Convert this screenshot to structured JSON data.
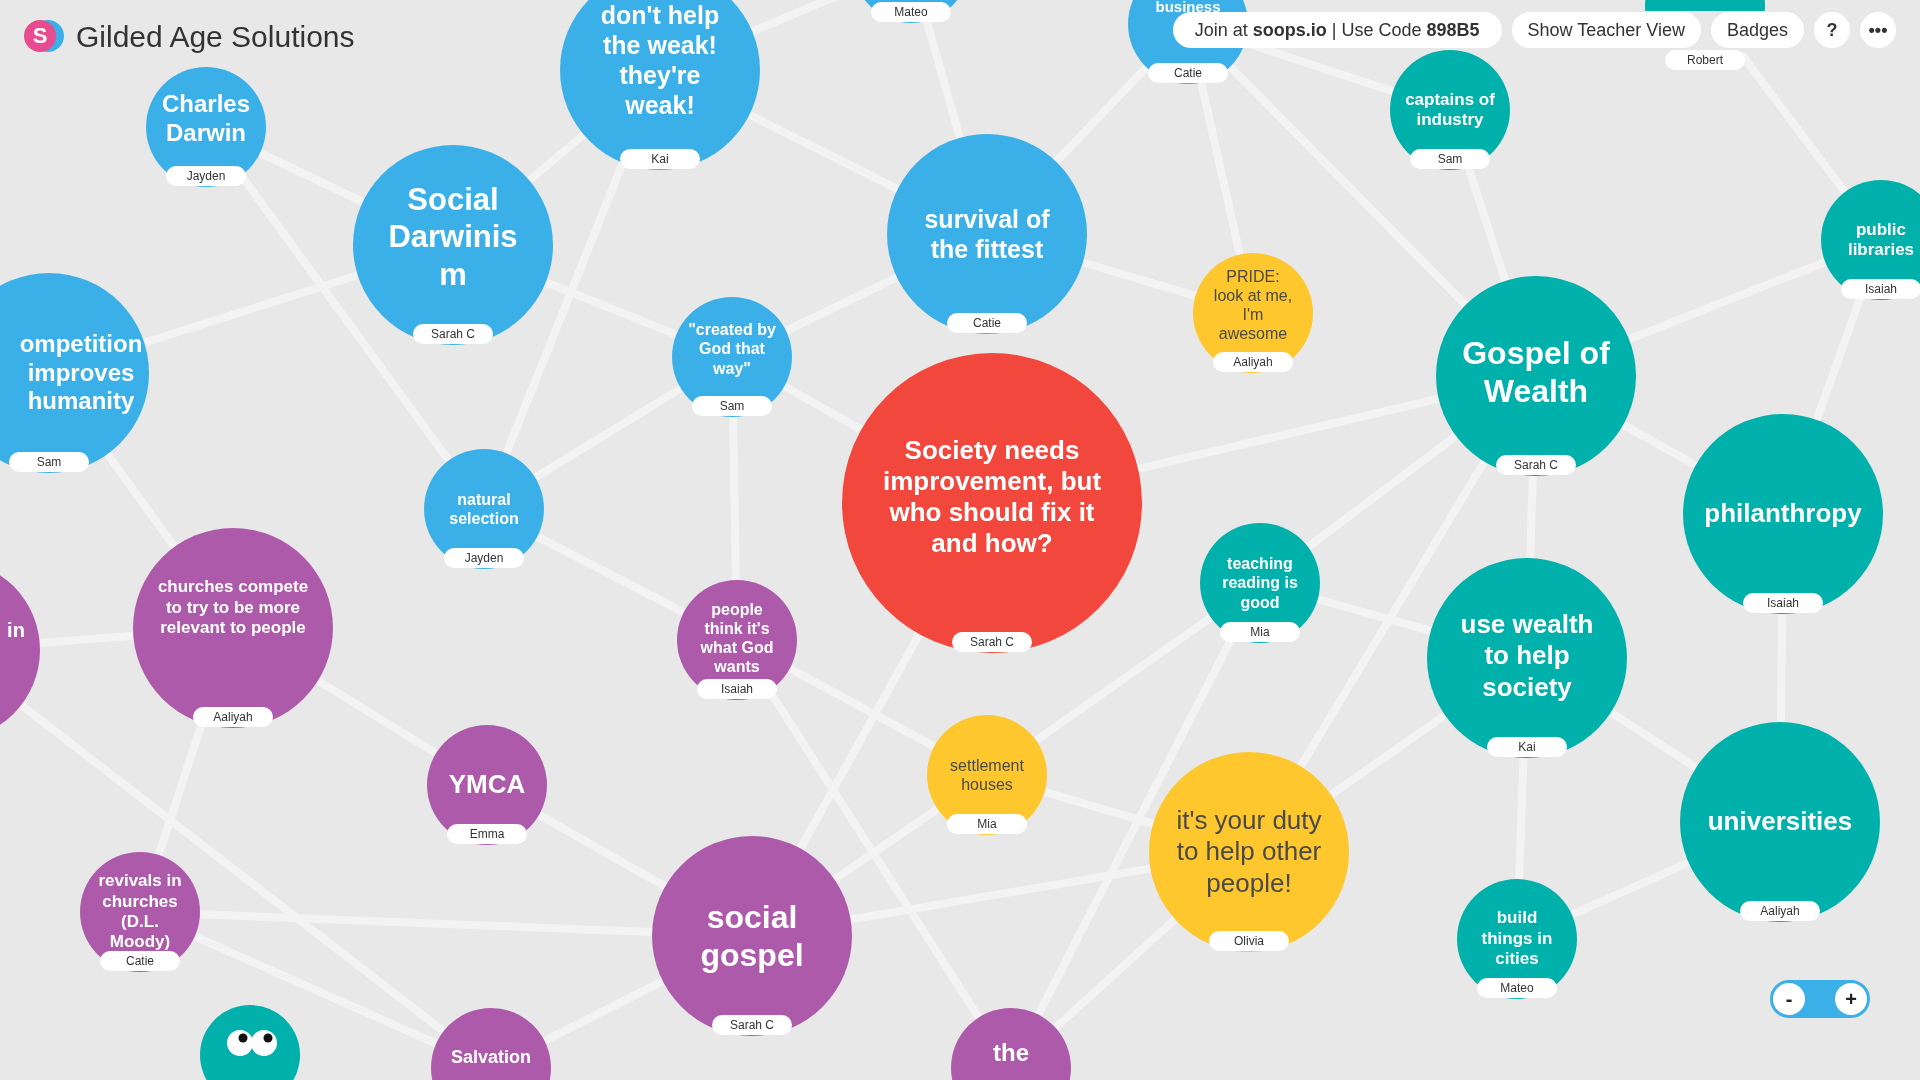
{
  "app": {
    "title": "Gilded Age Solutions",
    "logo": "S"
  },
  "toolbar": {
    "join_text": "Join at **soops.io** | Use Code **898B5**",
    "buttons": [
      "Show Teacher View",
      "Badges",
      "?",
      "•••"
    ]
  },
  "nodes": [
    {
      "text": "Charles\nDarwin",
      "author": "Jayden",
      "color": "#3bb0e8"
    },
    {
      "text": "Social\nDarwinis\nm",
      "author": "Sarah C",
      "color": "#3bb0e8"
    },
    {
      "text": "don't help\nthe weak!\nthey're\nweak!",
      "author": "Kai",
      "color": "#3bb0e8"
    },
    {
      "author": "Mateo",
      "color": "#3bb0e8"
    },
    {
      "text": "survival of\nthe fittest",
      "author": "Catie",
      "color": "#3bb0e8"
    },
    {
      "text": "business",
      "author": "Catie",
      "color": "#3bb0e8"
    },
    {
      "text": "captains of\nindustry",
      "author": "Sam",
      "color": "#00b0aa"
    },
    {
      "author": "Robert",
      "color": "#00b0aa"
    },
    {
      "text": "public\nlibraries",
      "author": "Isaiah",
      "color": "#00b0aa"
    },
    {
      "text": "ompetition\nimproves\nhumanity",
      "author": "Sam",
      "color": "#3bb0e8"
    },
    {
      "text": "\"created by\nGod that\nway\"",
      "author": "Sam",
      "color": "#3bb0e8"
    },
    {
      "text": "PRIDE:\nlook at me,\nI'm\nawesome",
      "author": "Aaliyah",
      "color": "#fec72d"
    },
    {
      "text": "Gospel of\nWealth",
      "author": "Sarah C",
      "color": "#00b0aa"
    },
    {
      "text": "natural\nselection",
      "author": "Jayden",
      "color": "#3bb0e8"
    },
    {
      "text": "Society needs\nimprovement, but\nwho should fix it\nand how?",
      "author": "Sarah C",
      "color": "#f2473d"
    },
    {
      "text": "philanthropy",
      "author": "Isaiah",
      "color": "#00b0aa"
    },
    {
      "text": "in",
      "color": "#ae5aab"
    },
    {
      "text": "churches compete\nto try to be more\nrelevant to people",
      "author": "Aaliyah",
      "color": "#ae5aab"
    },
    {
      "text": "people\nthink it's\nwhat God\nwants",
      "author": "Isaiah",
      "color": "#ae5aab"
    },
    {
      "text": "teaching\nreading is\ngood",
      "author": "Mia",
      "color": "#00b0aa"
    },
    {
      "text": "use wealth\nto help\nsociety",
      "author": "Kai",
      "color": "#00b0aa"
    },
    {
      "text": "YMCA",
      "author": "Emma",
      "color": "#ae5aab"
    },
    {
      "text": "settlement\nhouses",
      "author": "Mia",
      "color": "#fec72d"
    },
    {
      "text": "it's your duty\nto help other\npeople!",
      "author": "Olivia",
      "color": "#fec72d"
    },
    {
      "text": "universities",
      "author": "Aaliyah",
      "color": "#00b0aa"
    },
    {
      "text": "revivals in\nchurches\n(D.L.\nMoody)",
      "author": "Catie",
      "color": "#ae5aab"
    },
    {
      "text": "social\ngospel",
      "author": "Sarah C",
      "color": "#ae5aab"
    },
    {
      "text": "build\nthings in\ncities",
      "author": "Mateo",
      "color": "#00b0aa"
    },
    {
      "text": "Salvation",
      "color": "#ae5aab"
    },
    {
      "text": "the",
      "color": "#ae5aab"
    }
  ],
  "zoom_controls": [
    "-",
    "+"
  ]
}
